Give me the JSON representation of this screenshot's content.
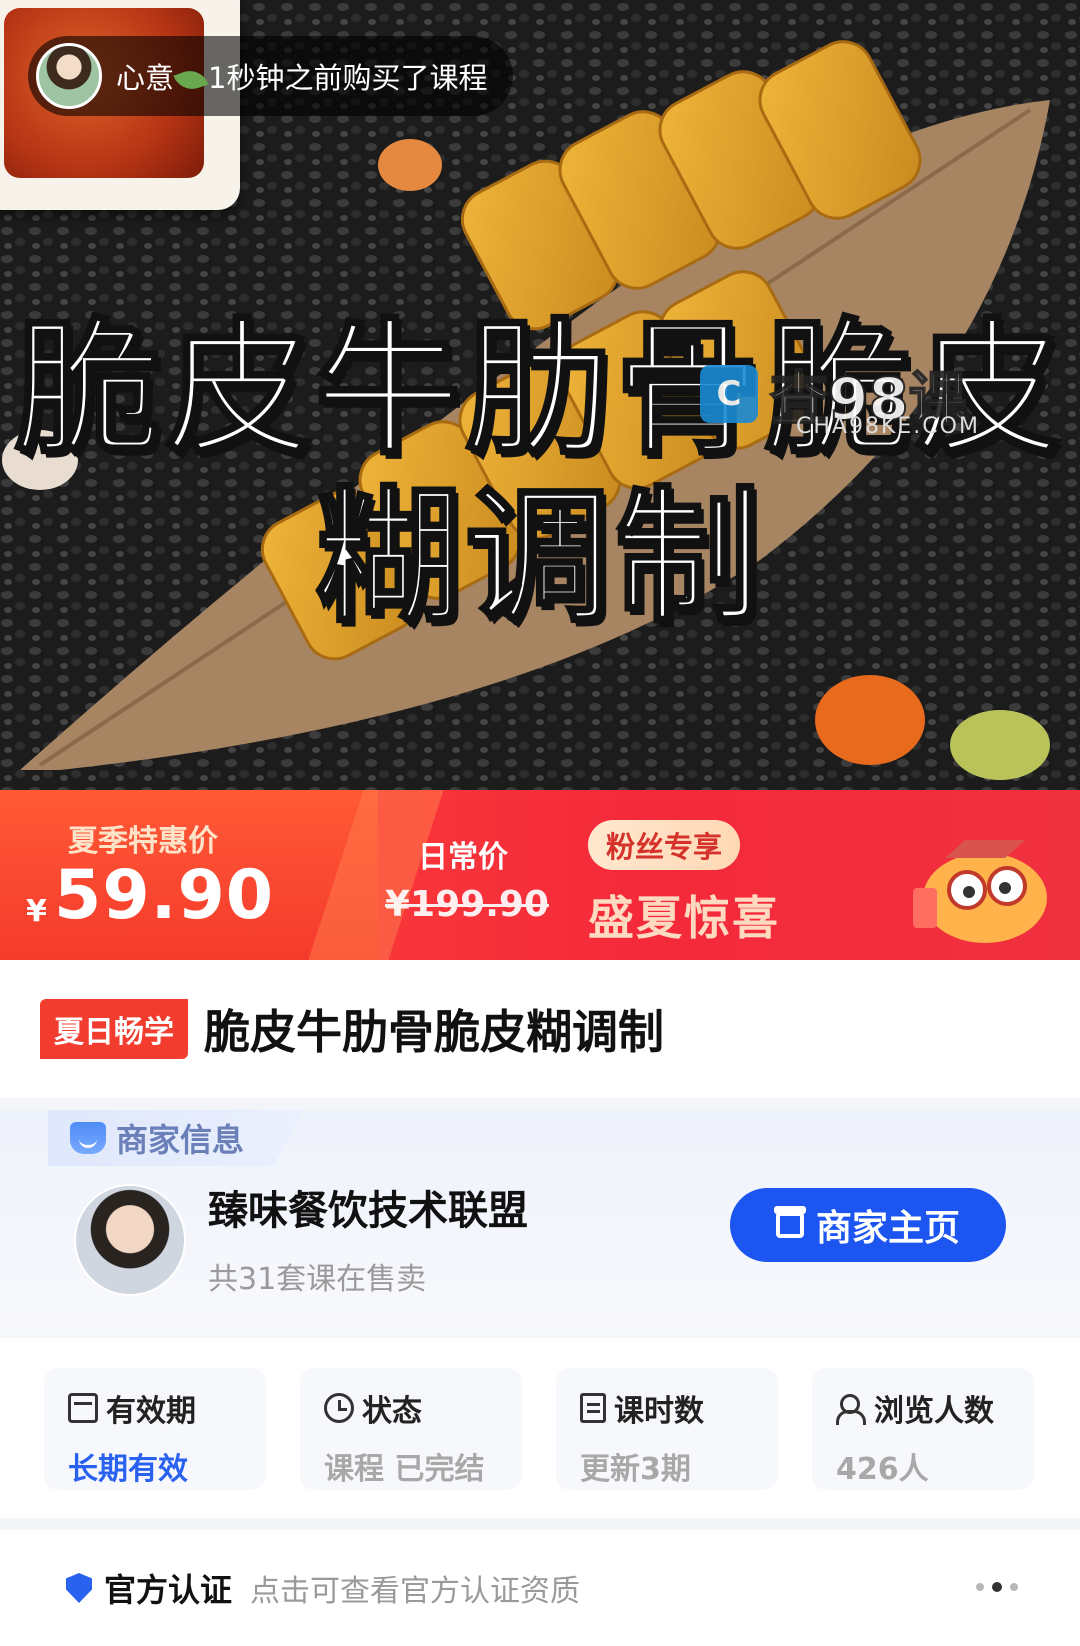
{
  "hero": {
    "toast": {
      "user": "心意",
      "message": "1秒钟之前购买了课程"
    },
    "title_line1": "脆皮牛肋骨脆皮",
    "title_line2": "糊调制",
    "watermark": {
      "badge": "C",
      "text": "查98课",
      "sub": "CHA98KE.COM"
    }
  },
  "price": {
    "promo_label": "夏季特惠价",
    "currency": "¥",
    "promo_value": "59.90",
    "regular_label": "日常价",
    "regular_value": "¥199.90",
    "fans_tag": "粉丝专享",
    "surprise": "盛夏惊喜",
    "colors": {
      "banner": "#f4293a",
      "fans_tag_text": "#d5322b"
    }
  },
  "course": {
    "tag": "夏日畅学",
    "title": "脆皮牛肋骨脆皮糊调制"
  },
  "merchant": {
    "section_label": "商家信息",
    "name": "臻味餐饮技术联盟",
    "count_text": "共31套课在售卖",
    "home_button": "商家主页",
    "button_color": "#1d55f0"
  },
  "stats": [
    {
      "icon": "calendar-icon",
      "label": "有效期",
      "value": "长期有效"
    },
    {
      "icon": "clock-icon",
      "label": "状态",
      "value": "课程 已完结"
    },
    {
      "icon": "document-icon",
      "label": "课时数",
      "value": "更新3期"
    },
    {
      "icon": "users-icon",
      "label": "浏览人数",
      "value": "426人"
    }
  ],
  "certification": {
    "label": "官方认证",
    "description": "点击可查看官方认证资质"
  }
}
